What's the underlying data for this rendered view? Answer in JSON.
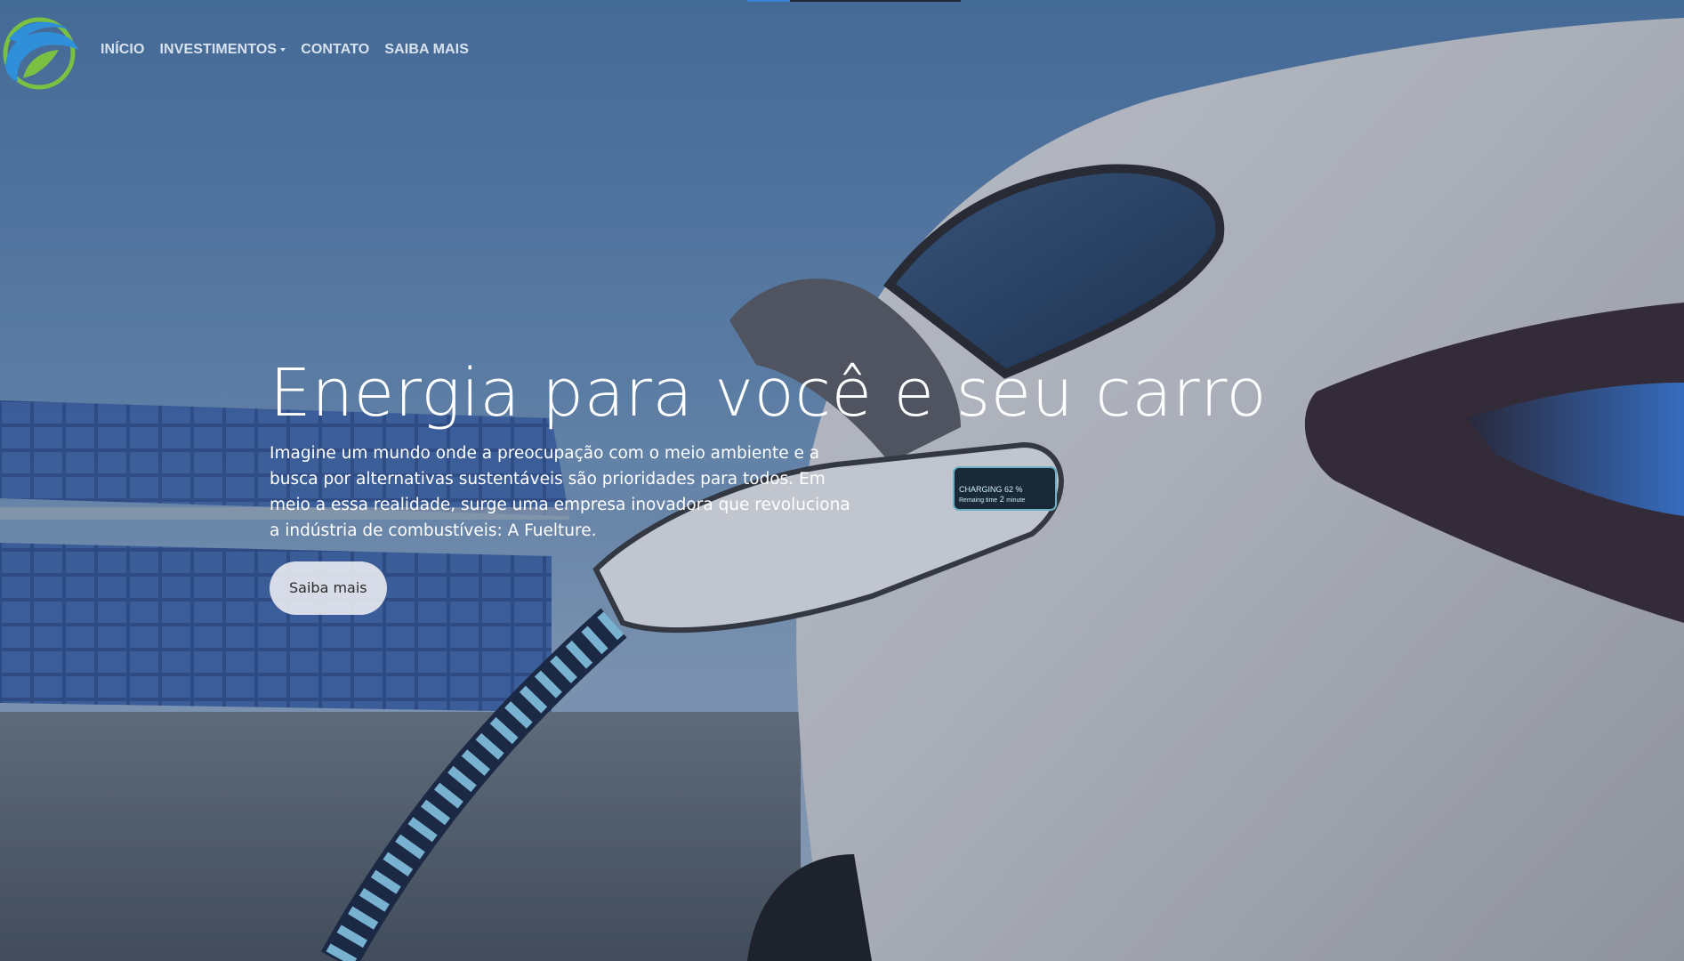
{
  "nav": {
    "logo_icon": "leaf-globe-logo",
    "links": [
      {
        "label": "INÍCIO"
      },
      {
        "label": "INVESTIMENTOS",
        "has_dropdown": true
      },
      {
        "label": "CONTATO"
      },
      {
        "label": "SAIBA MAIS"
      }
    ]
  },
  "hero": {
    "title": "Energia para você e seu carro",
    "text": "Imagine um mundo onde a preocupação com o meio ambiente e a busca por alternativas sustentáveis são prioridades para todos. Em meio a essa realidade, surge uma empresa inovadora que revoluciona a indústria de combustíveis: A Fuelture.",
    "button_label": "Saiba mais"
  },
  "charger_display": {
    "status": "CHARGING",
    "percent": "62 %",
    "remaining_label": "Remaing time",
    "remaining_value": "2",
    "remaining_unit": "minute"
  },
  "colors": {
    "nav_text": "#d8e2ee",
    "hero_text": "#ffffff",
    "sky": "#4f79a8",
    "button_bg": "#eeeef2",
    "logo_blue": "#2f8fd8",
    "logo_green": "#7ac143"
  }
}
